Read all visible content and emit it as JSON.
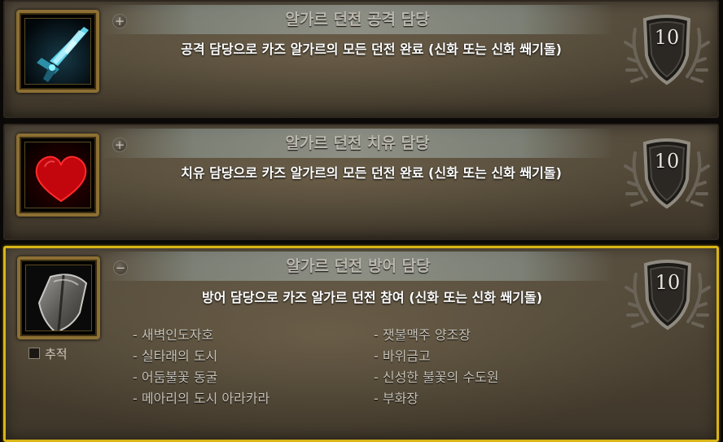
{
  "achievements": [
    {
      "title": "알가르 던전 공격 담당",
      "toggle": "+",
      "description": "공격 담당으로 카즈 알가르의 모든 던전 완료 (신화 또는 신화 쐐기돌)",
      "points": "10",
      "icon": "sword-icon",
      "selected": false
    },
    {
      "title": "알가르 던전 치유 담당",
      "toggle": "+",
      "description": "치유 담당으로 카즈 알가르의 모든 던전 완료 (신화 또는 신화 쐐기돌)",
      "points": "10",
      "icon": "heart-icon",
      "selected": false
    },
    {
      "title": "알가르 던전 방어 담당",
      "toggle": "−",
      "description": "방어 담당으로 카즈 알가르 던전 참여 (신화 또는 신화 쐐기돌)",
      "points": "10",
      "icon": "shield-icon",
      "selected": true,
      "track_label": "추적",
      "criteria": [
        "- 새벽인도자호",
        "- 실타래의 도시",
        "- 어둠불꽃 동굴",
        "- 메아리의 도시 아라카라",
        "- 잿불맥주 양조장",
        "- 바위금고",
        "- 신성한 불꽃의 수도원",
        "- 부화장"
      ]
    }
  ],
  "colors": {
    "selected_border": "#d9b516",
    "title_text": "#bcb8ae",
    "description_text": "#ffffff",
    "criteria_text": "#c7c2b7"
  }
}
